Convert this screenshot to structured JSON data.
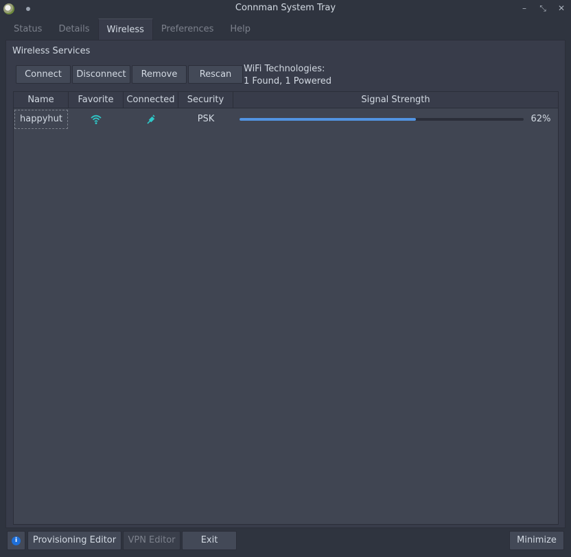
{
  "window": {
    "title": "Connman System Tray",
    "buttons": {
      "minimize": "–",
      "restore": "⤡",
      "close": "✕"
    }
  },
  "tabs": [
    {
      "label": "Status",
      "active": false
    },
    {
      "label": "Details",
      "active": false
    },
    {
      "label": "Wireless",
      "active": true
    },
    {
      "label": "Preferences",
      "active": false
    },
    {
      "label": "Help",
      "active": false
    }
  ],
  "wireless": {
    "section_title": "Wireless Services",
    "buttons": {
      "connect": "Connect",
      "disconnect": "Disconnect",
      "remove": "Remove",
      "rescan": "Rescan"
    },
    "technologies_line1": "WiFi Technologies:",
    "technologies_line2": "1 Found, 1 Powered",
    "table": {
      "columns": [
        "Name",
        "Favorite",
        "Connected",
        "Security",
        "Signal Strength"
      ],
      "rows": [
        {
          "name": "happyhut",
          "favorite_icon": "wifi-icon",
          "connected_icon": "connected-plug-icon",
          "security": "PSK",
          "signal_percent": 62,
          "signal_label": "62%"
        }
      ]
    }
  },
  "bottom": {
    "info_icon": "info-icon",
    "provisioning_editor": "Provisioning Editor",
    "vpn_editor": "VPN Editor",
    "exit": "Exit",
    "minimize": "Minimize"
  },
  "colors": {
    "accent": "#5294e2",
    "icon_teal": "#2ec8c8",
    "info_blue": "#1e6fd9"
  }
}
